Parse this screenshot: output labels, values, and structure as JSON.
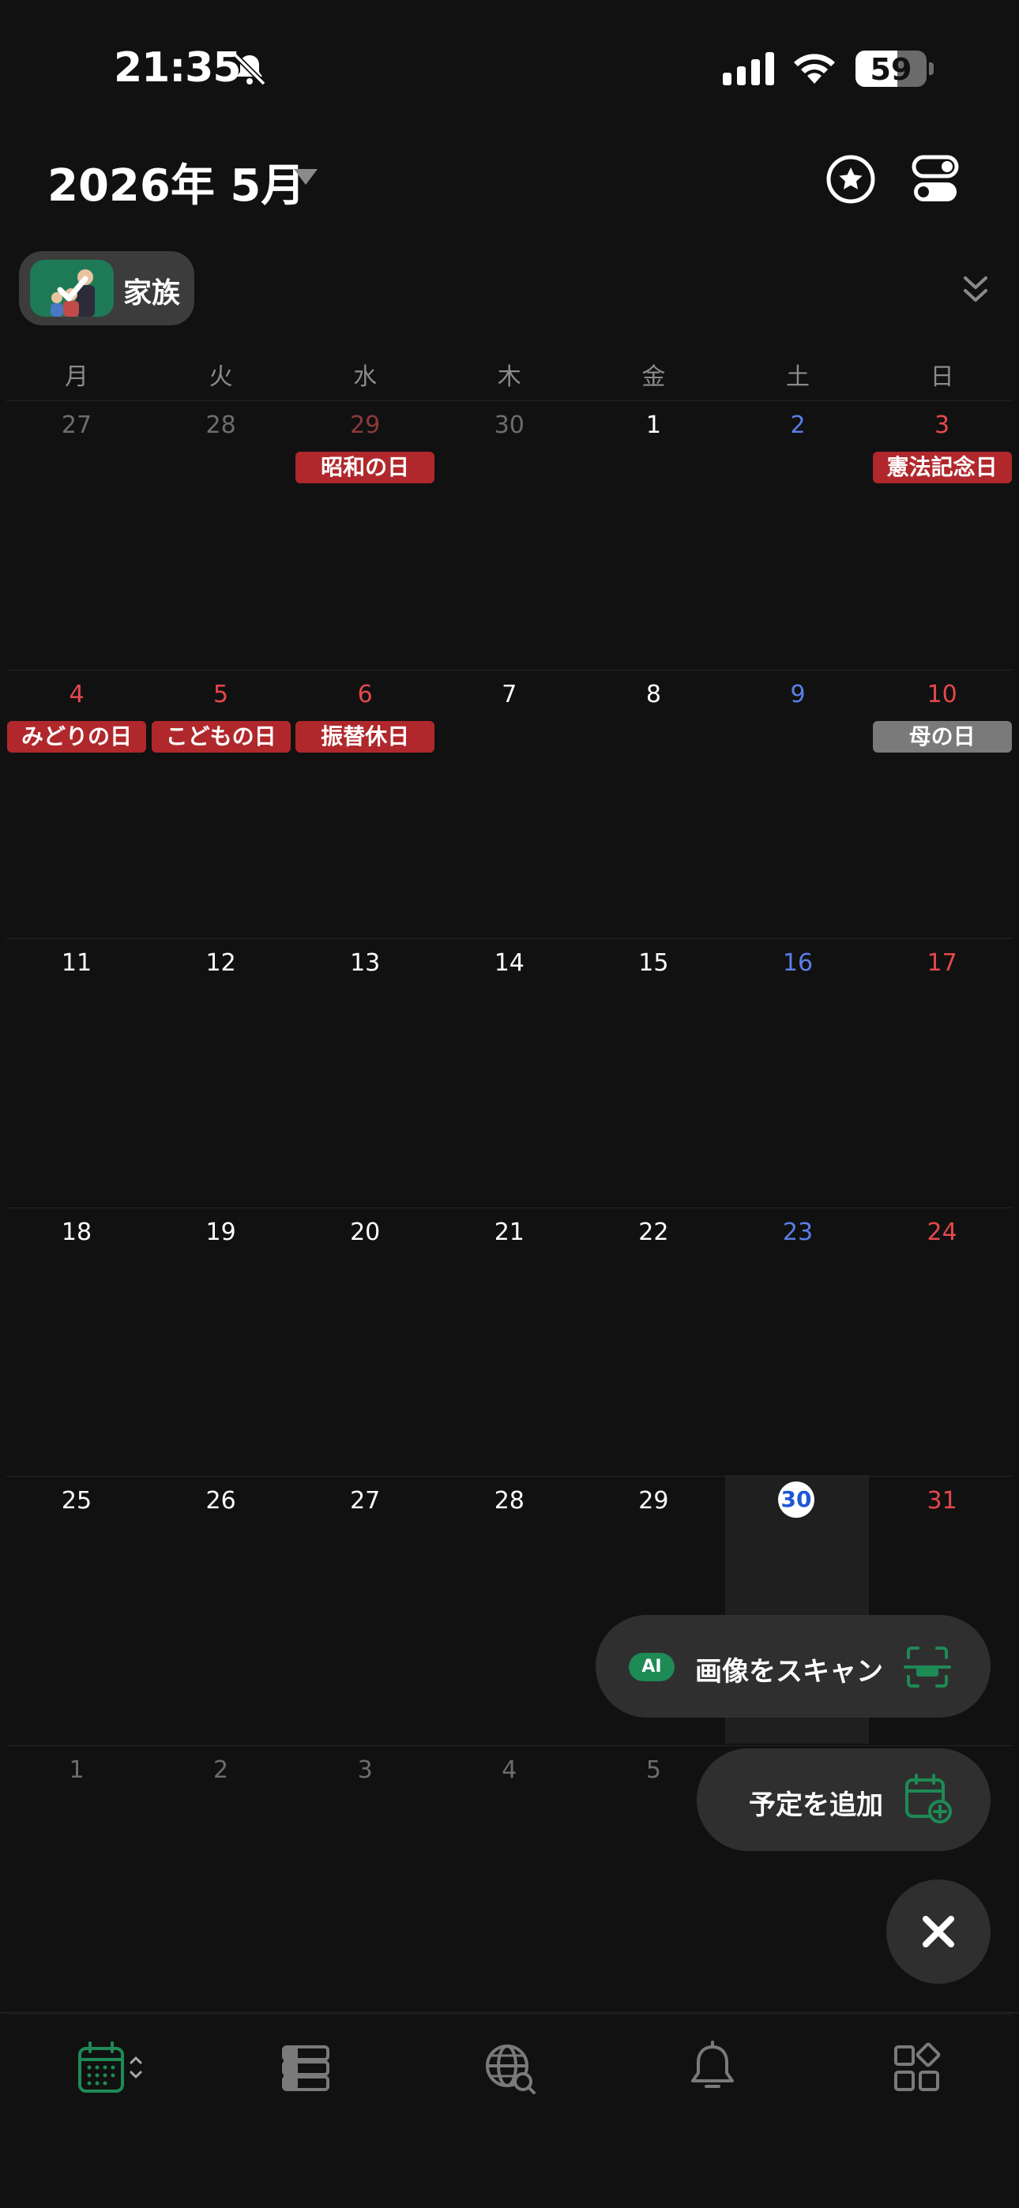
{
  "status_bar": {
    "time": "21:35",
    "battery": "59",
    "icons": [
      "bell-slash-icon",
      "cellular-signal-icon",
      "wifi-icon",
      "battery-icon"
    ]
  },
  "header": {
    "month_title": "2026年 5月",
    "icons": [
      "dropdown-caret-icon",
      "star-icon",
      "toggles-icon"
    ]
  },
  "calendar_chip": {
    "label": "家族",
    "selected": true
  },
  "weekdays": [
    "月",
    "火",
    "水",
    "木",
    "金",
    "土",
    "日"
  ],
  "weeks": [
    [
      {
        "day": "27",
        "color": "dim"
      },
      {
        "day": "28",
        "color": "dim"
      },
      {
        "day": "29",
        "color": "dimred",
        "holiday": "昭和の日"
      },
      {
        "day": "30",
        "color": "dim"
      },
      {
        "day": "1",
        "color": "white"
      },
      {
        "day": "2",
        "color": "blue"
      },
      {
        "day": "3",
        "color": "red",
        "holiday": "憲法記念日"
      }
    ],
    [
      {
        "day": "4",
        "color": "red",
        "holiday": "みどりの日"
      },
      {
        "day": "5",
        "color": "red",
        "holiday": "こどもの日"
      },
      {
        "day": "6",
        "color": "red",
        "holiday": "振替休日"
      },
      {
        "day": "7",
        "color": "white"
      },
      {
        "day": "8",
        "color": "white"
      },
      {
        "day": "9",
        "color": "blue"
      },
      {
        "day": "10",
        "color": "red",
        "holiday": "母の日",
        "holiday_style": "gray"
      }
    ],
    [
      {
        "day": "11",
        "color": "white"
      },
      {
        "day": "12",
        "color": "white"
      },
      {
        "day": "13",
        "color": "white"
      },
      {
        "day": "14",
        "color": "white"
      },
      {
        "day": "15",
        "color": "white"
      },
      {
        "day": "16",
        "color": "blue"
      },
      {
        "day": "17",
        "color": "red"
      }
    ],
    [
      {
        "day": "18",
        "color": "white"
      },
      {
        "day": "19",
        "color": "white"
      },
      {
        "day": "20",
        "color": "white"
      },
      {
        "day": "21",
        "color": "white"
      },
      {
        "day": "22",
        "color": "white"
      },
      {
        "day": "23",
        "color": "blue"
      },
      {
        "day": "24",
        "color": "red"
      }
    ],
    [
      {
        "day": "25",
        "color": "white"
      },
      {
        "day": "26",
        "color": "white"
      },
      {
        "day": "27",
        "color": "white"
      },
      {
        "day": "28",
        "color": "white"
      },
      {
        "day": "29",
        "color": "white"
      },
      {
        "day": "30",
        "color": "today"
      },
      {
        "day": "31",
        "color": "red"
      }
    ],
    [
      {
        "day": "1",
        "color": "dim"
      },
      {
        "day": "2",
        "color": "dim"
      },
      {
        "day": "3",
        "color": "dim"
      },
      {
        "day": "4",
        "color": "dim"
      },
      {
        "day": "5",
        "color": "dim"
      }
    ]
  ],
  "actions": {
    "scan_badge": "AI",
    "scan_label": "画像をスキャン",
    "add_label": "予定を追加"
  },
  "tabbar": [
    "calendar-tab-icon",
    "list-tab-icon",
    "globe-search-tab-icon",
    "bell-tab-icon",
    "widgets-tab-icon"
  ],
  "colors": {
    "accent": "#1e8a55",
    "holiday": "#b0282c",
    "saturday": "#5b7ee8",
    "sunday": "#e5484d",
    "today": "#1f57d6"
  }
}
